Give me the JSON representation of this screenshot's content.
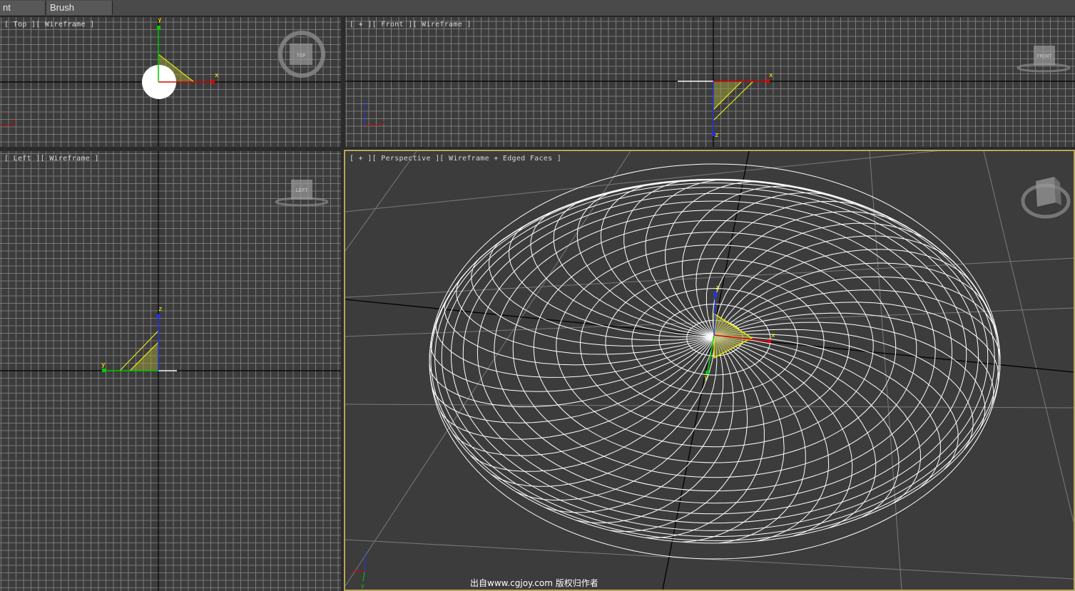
{
  "menu": {
    "items": [
      "nt Objects",
      "Brush Settings"
    ]
  },
  "viewports": {
    "top": {
      "label": "[ Top ][ Wireframe ]",
      "cube": "TOP"
    },
    "front": {
      "label": "[ + ][ Front ][ Wireframe ]",
      "cube": "FRONT"
    },
    "left": {
      "label": "[ Left ][ Wireframe ]",
      "cube": "LEFT"
    },
    "perspective": {
      "label": "[ + ][ Perspective ][ Wireframe + Edged Faces ]"
    }
  },
  "axes": {
    "x": "x",
    "y": "y",
    "z": "z"
  },
  "watermark": "出自www.cgjoy.com 版权归作者",
  "colors": {
    "grid": "#8a8a8a",
    "axis": "#000000",
    "selection": "#ffff00",
    "active_border": "#b9a55a"
  }
}
